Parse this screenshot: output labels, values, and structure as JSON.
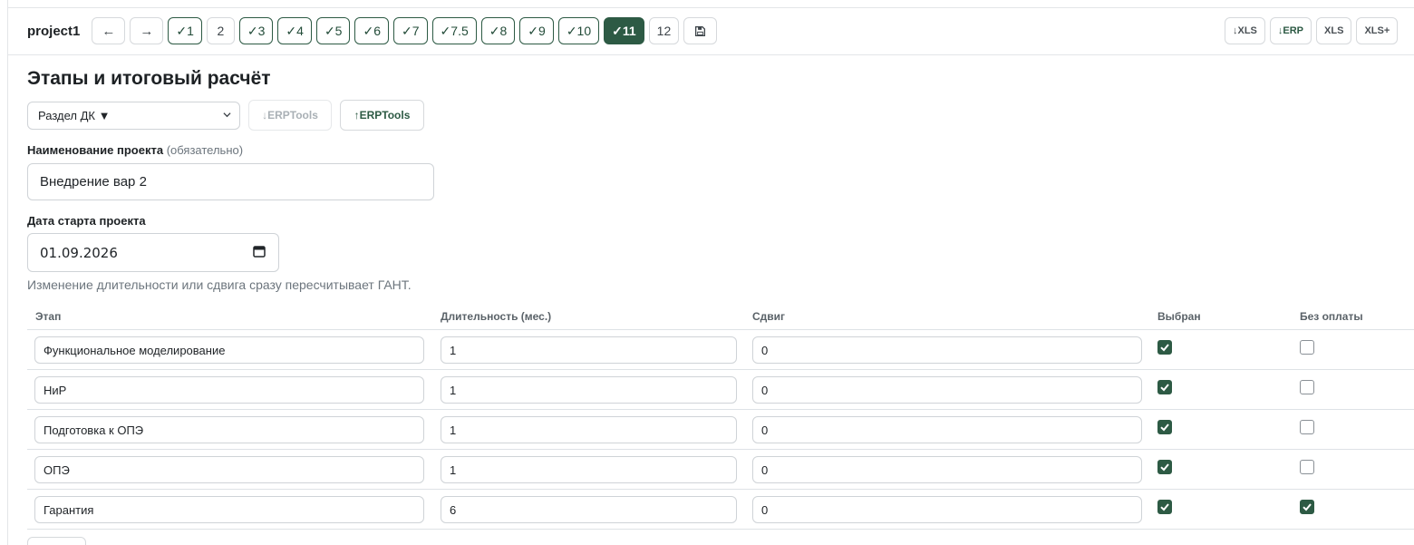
{
  "project": {
    "name": "project1"
  },
  "nav": {
    "back_label": "←",
    "forward_label": "→",
    "steps": [
      {
        "label": "✓1",
        "state": "done"
      },
      {
        "label": "2",
        "state": "pending"
      },
      {
        "label": "✓3",
        "state": "done"
      },
      {
        "label": "✓4",
        "state": "done"
      },
      {
        "label": "✓5",
        "state": "done"
      },
      {
        "label": "✓6",
        "state": "done"
      },
      {
        "label": "✓7",
        "state": "done"
      },
      {
        "label": "✓7.5",
        "state": "done"
      },
      {
        "label": "✓8",
        "state": "done"
      },
      {
        "label": "✓9",
        "state": "done"
      },
      {
        "label": "✓10",
        "state": "done"
      },
      {
        "label": "✓11",
        "state": "active"
      },
      {
        "label": "12",
        "state": "pending"
      }
    ],
    "save_icon": "save-icon"
  },
  "export": {
    "download_xls": "↓XLS",
    "download_erp": "↓ERP",
    "xls": "XLS",
    "xls_plus": "XLS+"
  },
  "page": {
    "title": "Этапы и итоговый расчёт",
    "section_select": "Раздел ДК ▼",
    "erp_down": "↓ERPTools",
    "erp_up": "↑ERPTools"
  },
  "form": {
    "name_label": "Наименование проекта",
    "name_hint": "(обязательно)",
    "name_value": "Внедрение вар 2",
    "date_label": "Дата старта проекта",
    "date_value": "01.09.2026",
    "note": "Изменение длительности или сдвига сразу пересчитывает ГАНТ."
  },
  "table": {
    "headers": {
      "stage": "Этап",
      "duration": "Длительность (мес.)",
      "shift": "Сдвиг",
      "selected": "Выбран",
      "no_payment": "Без оплаты"
    },
    "rows": [
      {
        "stage": "Функциональное моделирование",
        "duration": "1",
        "shift": "0",
        "selected": true,
        "no_payment": false
      },
      {
        "stage": "НиР",
        "duration": "1",
        "shift": "0",
        "selected": true,
        "no_payment": false
      },
      {
        "stage": "Подготовка к ОПЭ",
        "duration": "1",
        "shift": "0",
        "selected": true,
        "no_payment": false
      },
      {
        "stage": "ОПЭ",
        "duration": "1",
        "shift": "0",
        "selected": true,
        "no_payment": false
      },
      {
        "stage": "Гарантия",
        "duration": "6",
        "shift": "0",
        "selected": true,
        "no_payment": true
      }
    ]
  },
  "colors": {
    "accent": "#2d5a44",
    "border": "#cfd3d7",
    "muted_text": "#6c757d"
  }
}
